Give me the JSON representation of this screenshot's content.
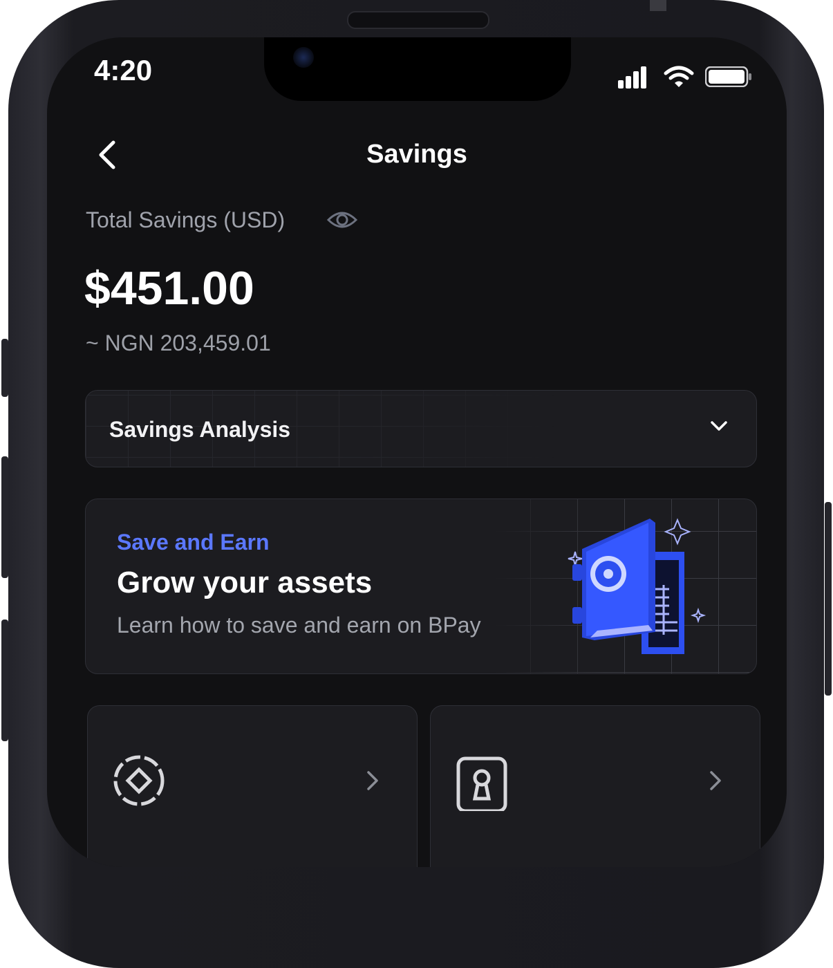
{
  "status_bar": {
    "time": "4:20"
  },
  "nav": {
    "title": "Savings"
  },
  "balance": {
    "label": "Total Savings (USD)",
    "amount": "$451.00",
    "converted": "~ NGN 203,459.01"
  },
  "analysis": {
    "label": "Savings Analysis"
  },
  "promo": {
    "eyebrow": "Save and Earn",
    "title": "Grow your assets",
    "subtitle": "Learn how to save and earn on BPay",
    "illustration": "vault-safe-illustration"
  },
  "tiles": [
    {
      "icon": "target-coin-icon"
    },
    {
      "icon": "lock-safe-icon"
    }
  ],
  "colors": {
    "background": "#111113",
    "card": "#1c1c20",
    "accent": "#5b78ff",
    "safe_blue": "#2d4ff0"
  }
}
